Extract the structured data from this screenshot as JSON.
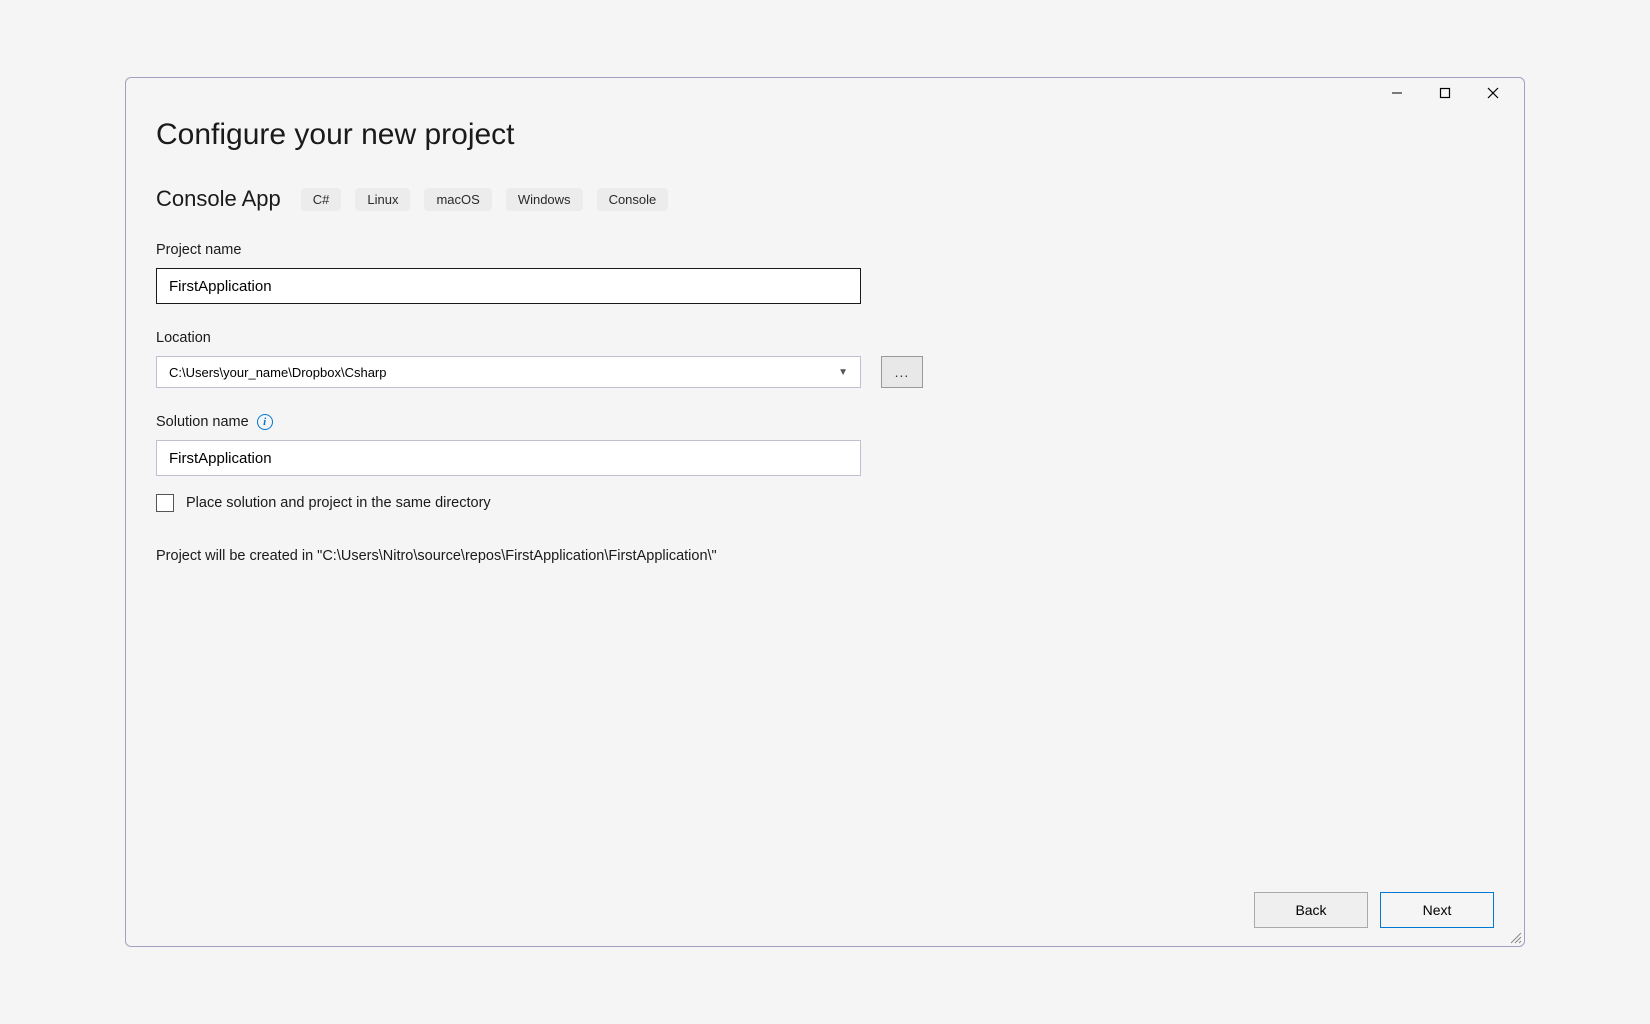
{
  "header": {
    "title": "Configure your new project"
  },
  "project": {
    "type_name": "Console App",
    "tags": [
      "C#",
      "Linux",
      "macOS",
      "Windows",
      "Console"
    ]
  },
  "fields": {
    "project_name": {
      "label": "Project name",
      "value": "FirstApplication"
    },
    "location": {
      "label": "Location",
      "value": "C:\\Users\\your_name\\Dropbox\\Csharp",
      "browse_label": "..."
    },
    "solution_name": {
      "label": "Solution name",
      "value": "FirstApplication"
    },
    "same_directory": {
      "label": "Place solution and project in the same directory",
      "checked": false
    }
  },
  "status": {
    "path_message": "Project will be created in \"C:\\Users\\Nitro\\source\\repos\\FirstApplication\\FirstApplication\\\""
  },
  "footer": {
    "back": "Back",
    "next": "Next"
  }
}
